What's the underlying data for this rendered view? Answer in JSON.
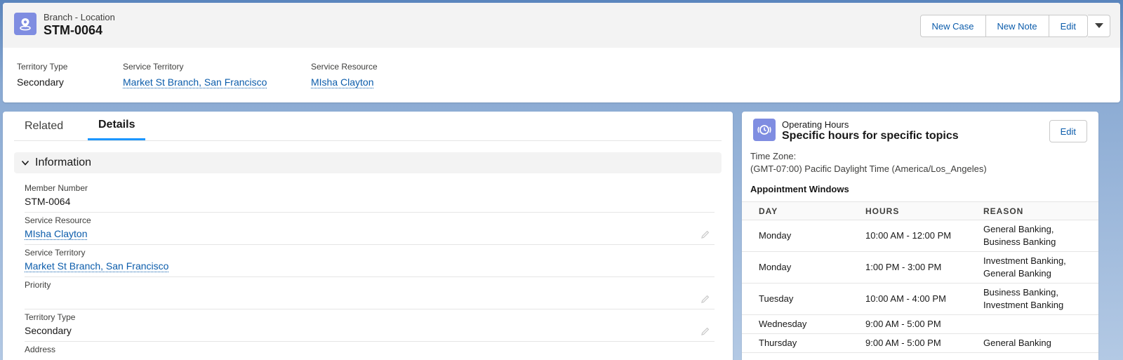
{
  "record": {
    "object_type": "Branch - Location",
    "name": "STM-0064",
    "icon": "location-pin-icon",
    "accent_color": "#7f8de1"
  },
  "actions": {
    "new_case": "New Case",
    "new_note": "New Note",
    "edit": "Edit",
    "more_icon": "chevron-down-icon"
  },
  "highlights": [
    {
      "label": "Territory Type",
      "value": "Secondary"
    },
    {
      "label": "Service Territory",
      "value": "Market St Branch, San Francisco"
    },
    {
      "label": "Service Resource",
      "value": "MIsha Clayton"
    }
  ],
  "tabs": [
    {
      "label": "Related"
    },
    {
      "label": "Details"
    }
  ],
  "active_tab": "Details",
  "section": {
    "title": "Information",
    "fields": [
      {
        "label": "Member Number",
        "value": "STM-0064"
      },
      {
        "label": "Service Resource",
        "value": "MIsha Clayton"
      },
      {
        "label": "Service Territory",
        "value": "Market St Branch, San Francisco"
      },
      {
        "label": "Priority",
        "value": ""
      },
      {
        "label": "Territory Type",
        "value": "Secondary"
      },
      {
        "label": "Address",
        "value": ""
      }
    ]
  },
  "operating_hours": {
    "type_label": "Operating Hours",
    "name": "Specific hours for specific topics",
    "edit_label": "Edit",
    "icon": "clock-icon",
    "time_zone_label": "Time Zone:",
    "time_zone_value": "(GMT-07:00) Pacific Daylight Time (America/Los_Angeles)",
    "windows_title": "Appointment Windows",
    "columns": [
      "DAY",
      "HOURS",
      "REASON"
    ],
    "rows": [
      {
        "day": "Monday",
        "hours": "10:00 AM - 12:00 PM",
        "reason_1": "General Banking,",
        "reason_2": "Business Banking"
      },
      {
        "day": "Monday",
        "hours": "1:00 PM - 3:00 PM",
        "reason_1": "Investment Banking,",
        "reason_2": "General Banking"
      },
      {
        "day": "Tuesday",
        "hours": "10:00 AM - 4:00 PM",
        "reason_1": "Business Banking,",
        "reason_2": "Investment Banking"
      },
      {
        "day": "Wednesday",
        "hours": "9:00 AM - 5:00 PM",
        "reason_1": "",
        "reason_2": ""
      },
      {
        "day": "Thursday",
        "hours": "9:00 AM - 5:00 PM",
        "reason_1": "General Banking",
        "reason_2": ""
      }
    ]
  },
  "colors": {
    "link": "#0b5cab",
    "tab_active": "#1b96ff"
  }
}
